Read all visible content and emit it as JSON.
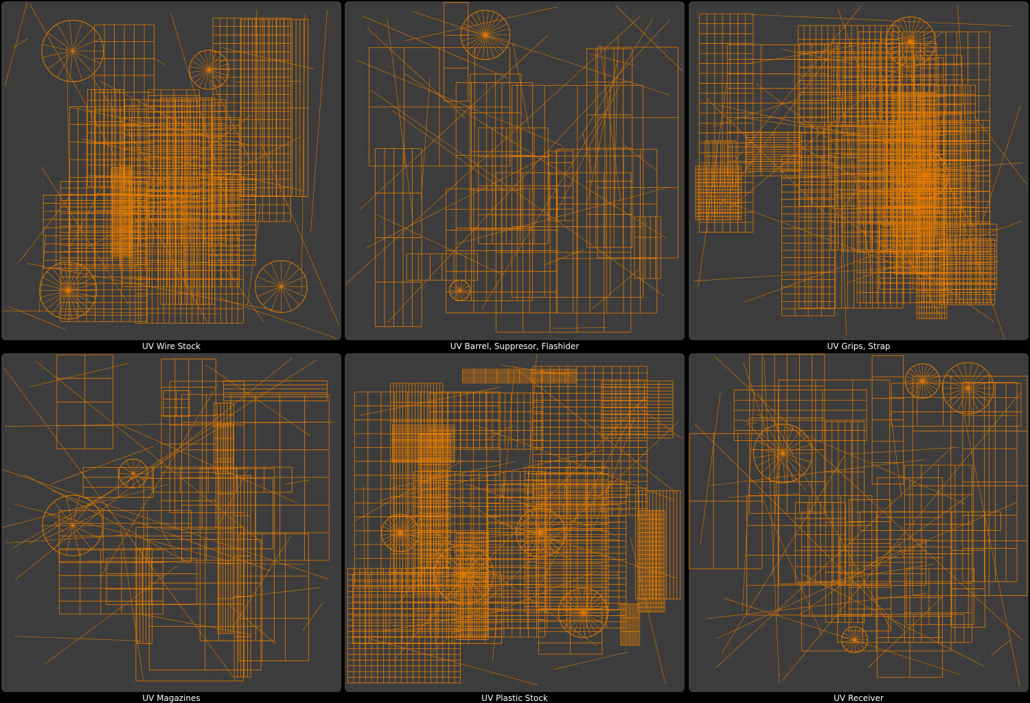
{
  "colors": {
    "background": "#000000",
    "panel": "#3c3c3c",
    "grid": "#454545",
    "wire": "#e87d00",
    "vertex": "#ff8c00",
    "label": "#ffffff"
  },
  "panels": [
    {
      "label": "UV Wire Stock"
    },
    {
      "label": "UV Barrel, Suppresor, Flashider"
    },
    {
      "label": "UV Grips, Strap"
    },
    {
      "label": "UV Magazines"
    },
    {
      "label": "UV Plastic Stock"
    },
    {
      "label": "UV Receiver"
    }
  ]
}
